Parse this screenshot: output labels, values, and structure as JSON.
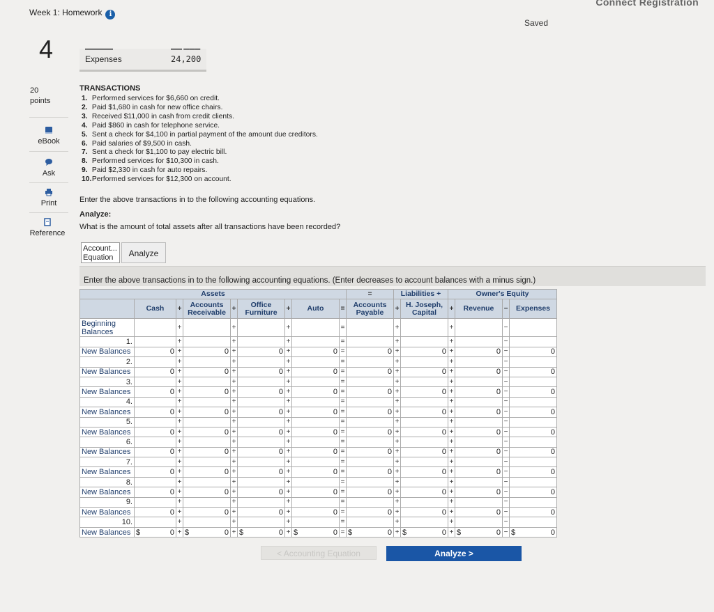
{
  "header": {
    "brand": "Connect Registration",
    "title": "Week 1: Homework",
    "info_icon": "i",
    "saved": "Saved"
  },
  "question": {
    "number": "4",
    "expenses_label": "Expenses",
    "expenses_value": "24,200",
    "points": "20",
    "points_label": "points"
  },
  "sidebar": {
    "ebook": "eBook",
    "ask": "Ask",
    "print": "Print",
    "reference": "Reference"
  },
  "transactions": {
    "title": "TRANSACTIONS",
    "items": [
      {
        "n": "1.",
        "text": "Performed services for $6,660 on credit."
      },
      {
        "n": "2.",
        "text": "Paid $1,680 in cash for new office chairs."
      },
      {
        "n": "3.",
        "text": "Received $11,000 in cash from credit clients."
      },
      {
        "n": "4.",
        "text": "Paid $860 in cash for telephone service."
      },
      {
        "n": "5.",
        "text": "Sent a check for $4,100 in partial payment of the amount due creditors."
      },
      {
        "n": "6.",
        "text": "Paid salaries of $9,500 in cash."
      },
      {
        "n": "7.",
        "text": "Sent a check for $1,100 to pay electric bill."
      },
      {
        "n": "8.",
        "text": "Performed services for $10,300 in cash."
      },
      {
        "n": "9.",
        "text": "Paid $2,330 in cash for auto repairs."
      },
      {
        "n": "10.",
        "text": "Performed services for $12,300 on account."
      }
    ],
    "instruction": "Enter the above transactions in to the following accounting equations.",
    "analyze_title": "Analyze:",
    "analyze_question": "What is the amount of total assets after all transactions have been recorded?"
  },
  "tabs": {
    "accounting_equation": "Account... Equation",
    "analyze": "Analyze"
  },
  "worksheet": {
    "instruction": "Enter the above transactions in to the following accounting equations. (Enter decreases to account balances with a minus sign.)",
    "group_assets": "Assets",
    "group_liabilities": "Liabilities",
    "group_equity": "Owner's Equity",
    "eq": "=",
    "plus": "+",
    "minus": "−",
    "col_cash": "Cash",
    "col_ar": "Accounts Receivable",
    "col_office": "Office Furniture",
    "col_auto": "Auto",
    "col_ap": "Accounts Payable",
    "col_capital": "H. Joseph, Capital",
    "col_revenue": "Revenue",
    "col_expenses": "Expenses",
    "beginning": "Beginning Balances",
    "new_balances": "New Balances",
    "dollar": "$",
    "zero": "0",
    "indices": [
      "1.",
      "2.",
      "3.",
      "4.",
      "5.",
      "6.",
      "7.",
      "8.",
      "9.",
      "10."
    ]
  },
  "nav": {
    "prev": "Accounting Equation",
    "next": "Analyze"
  }
}
